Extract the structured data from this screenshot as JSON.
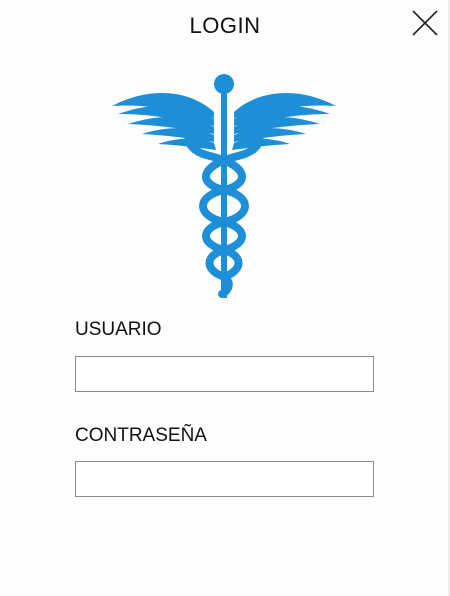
{
  "header": {
    "title": "LOGIN",
    "close_icon": "close-x-icon"
  },
  "logo": {
    "icon": "caduceus-icon",
    "color": "#1e8fd6"
  },
  "form": {
    "username_label": "USUARIO",
    "username_value": "",
    "password_label": "CONTRASEÑA",
    "password_value": ""
  }
}
